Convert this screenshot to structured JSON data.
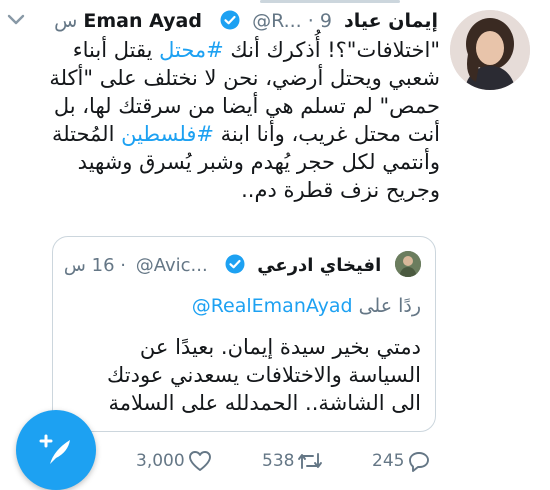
{
  "tweet": {
    "name_ar": "إيمان عياد",
    "name_en": "Eman Ayad",
    "handle": "@R...",
    "time": "9 س",
    "dot": "·",
    "text_before_1": "\"اختلافات\"؟! أُذكرك أنك ",
    "hashtag_1": "#محتل",
    "text_after_1": " يقتل أبناء\nشعبي ويحتل أرضي، نحن لا نختلف على \"أكلة\nحمص\" لم تسلم هي أيضا من سرقتك لها، بل\nأنت محتل غريب، وأنا ابنة ",
    "hashtag_2": "#فلسطين",
    "text_after_2": " المُحتلة\nوأنتمي لكل حجر يُهدم وشبر يُسرق وشهيد\nوجريح نزف قطرة دم.."
  },
  "quoted": {
    "name": "افيخاي ادرعي",
    "handle": "@Avic...",
    "time": "16 س",
    "dot": "·",
    "reply_prefix": "ردًا على",
    "reply_mention": "@RealEmanAyad",
    "text": "دمتي بخير سيدة إيمان. بعيدًا عن\nالسياسة والاختلافات يسعدني عودتك\nالى الشاشة.. الحمدلله على السلامة"
  },
  "actions": {
    "likes": "3,000",
    "retweets": "538",
    "replies": "245"
  },
  "colors": {
    "accent": "#1da1f2",
    "muted": "#657786"
  }
}
